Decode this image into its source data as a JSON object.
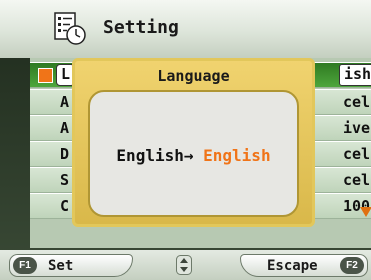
{
  "header": {
    "title": "Setting",
    "icon": "setting-icon"
  },
  "list": {
    "rows": [
      {
        "label": "L",
        "value": "ish"
      },
      {
        "label": "A",
        "value": "cel"
      },
      {
        "label": "A",
        "value": "ive"
      },
      {
        "label": "D",
        "value": "cel"
      },
      {
        "label": "S",
        "value": "cel"
      },
      {
        "label": "C",
        "value": "100"
      }
    ]
  },
  "dialog": {
    "title": "Language",
    "current": "English",
    "arrow": "→",
    "new_value": "English"
  },
  "footer": {
    "set_key": "F1",
    "set_label": "Set",
    "escape_key": "F2",
    "escape_label": "Escape",
    "nav_icon": "up-down-arrows-icon"
  },
  "colors": {
    "accent": "#f07418",
    "dialog_frame": "#e2c75b",
    "selected_row": "#3d8e2e"
  }
}
